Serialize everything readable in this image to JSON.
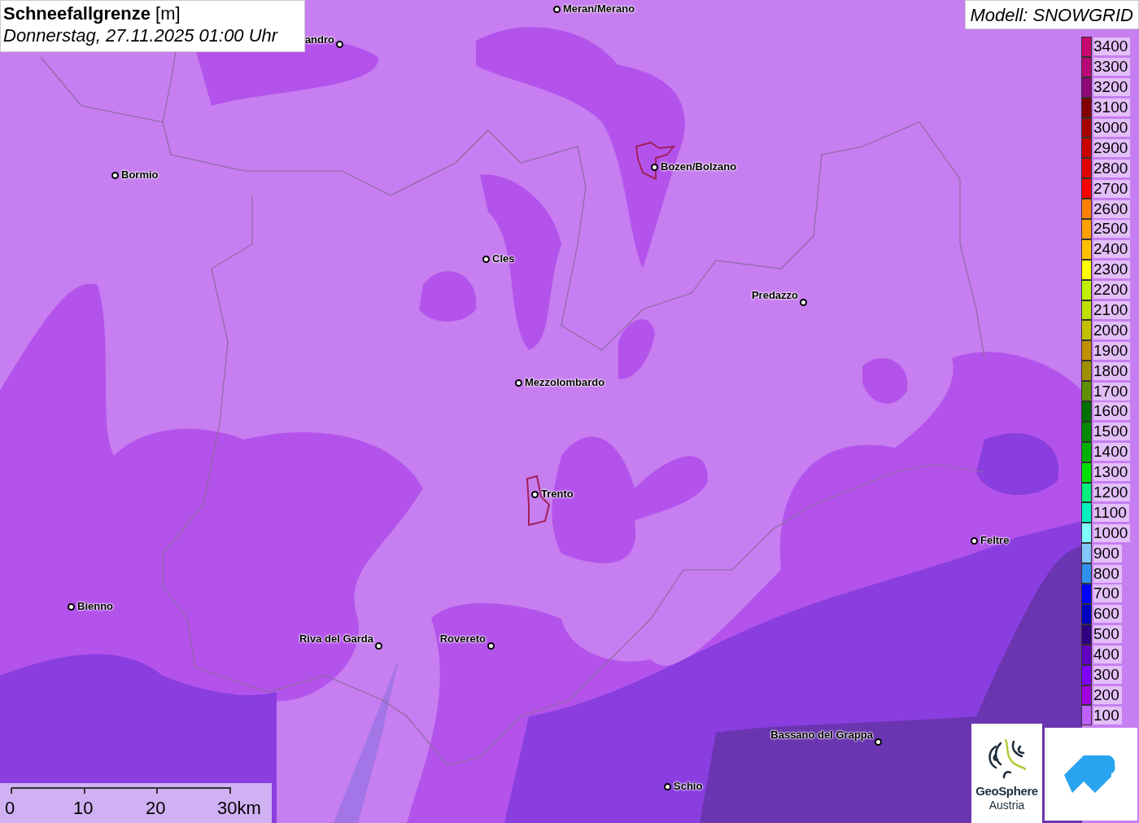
{
  "title": {
    "parameter": "Schneefallgrenze",
    "unit": "[m]",
    "datetime": "Donnerstag, 27.11.2025 01:00 Uhr"
  },
  "model": "Modell: SNOWGRID",
  "places": [
    {
      "name": "Meran/Merano"
    },
    {
      "name": "andro"
    },
    {
      "name": "Bormio"
    },
    {
      "name": "Bozen/Bolzano"
    },
    {
      "name": "Cles"
    },
    {
      "name": "Predazzo"
    },
    {
      "name": "Mezzolombardo"
    },
    {
      "name": "Trento"
    },
    {
      "name": "Feltre"
    },
    {
      "name": "Bienno"
    },
    {
      "name": "Riva del Garda"
    },
    {
      "name": "Rovereto"
    },
    {
      "name": "Bassano del Grappa"
    },
    {
      "name": "Schio"
    }
  ],
  "legend": [
    {
      "label": "3400",
      "color": "#c8086c"
    },
    {
      "label": "3300",
      "color": "#b80878"
    },
    {
      "label": "3200",
      "color": "#900878"
    },
    {
      "label": "3100",
      "color": "#800000"
    },
    {
      "label": "3000",
      "color": "#a80000"
    },
    {
      "label": "2900",
      "color": "#c80000"
    },
    {
      "label": "2800",
      "color": "#e00000"
    },
    {
      "label": "2700",
      "color": "#ff0000"
    },
    {
      "label": "2600",
      "color": "#ff8000"
    },
    {
      "label": "2500",
      "color": "#ffa000"
    },
    {
      "label": "2400",
      "color": "#ffc000"
    },
    {
      "label": "2300",
      "color": "#ffff00"
    },
    {
      "label": "2200",
      "color": "#c0f000"
    },
    {
      "label": "2100",
      "color": "#c0e000"
    },
    {
      "label": "2000",
      "color": "#c0c000"
    },
    {
      "label": "1900",
      "color": "#c09000"
    },
    {
      "label": "1800",
      "color": "#a09000"
    },
    {
      "label": "1700",
      "color": "#609000"
    },
    {
      "label": "1600",
      "color": "#007000"
    },
    {
      "label": "1500",
      "color": "#008800"
    },
    {
      "label": "1400",
      "color": "#00b000"
    },
    {
      "label": "1300",
      "color": "#00e000"
    },
    {
      "label": "1200",
      "color": "#00f080"
    },
    {
      "label": "1100",
      "color": "#00f0c0"
    },
    {
      "label": "1000",
      "color": "#80ffff"
    },
    {
      "label": "900",
      "color": "#80c8ff"
    },
    {
      "label": "800",
      "color": "#3090f0"
    },
    {
      "label": "700",
      "color": "#0000ff"
    },
    {
      "label": "600",
      "color": "#0000c0"
    },
    {
      "label": "500",
      "color": "#300080"
    },
    {
      "label": "400",
      "color": "#6000c0"
    },
    {
      "label": "300",
      "color": "#8000ff"
    },
    {
      "label": "200",
      "color": "#a000e0"
    },
    {
      "label": "100",
      "color": "#c060ff"
    }
  ],
  "scale_bar": [
    "0",
    "10",
    "20",
    "30km"
  ],
  "logo": {
    "line1": "GeoSphere",
    "line2": "Austria"
  }
}
